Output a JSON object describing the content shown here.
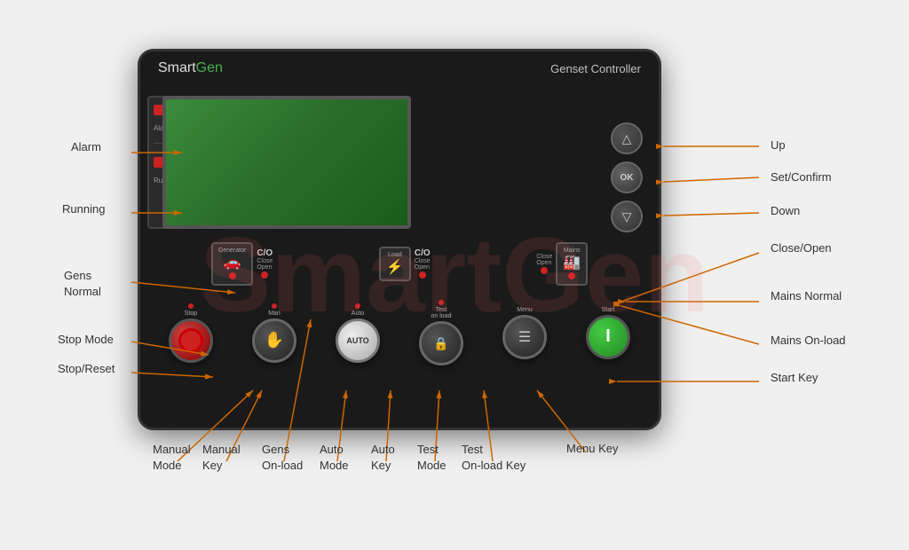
{
  "device": {
    "brand_smart": "Smart",
    "brand_gen": "Gen",
    "title": "Genset Controller"
  },
  "indicators": {
    "alarm_label": "Alarm",
    "running_label": "Running"
  },
  "contactors": {
    "generator_label": "Generator",
    "load_label": "Load",
    "mains_label": "Mains",
    "co_label": "C/O",
    "close_open": "Close\nOpen"
  },
  "buttons": {
    "stop_label": "Stop",
    "man_label": "Man",
    "auto_label": "AUTO",
    "test_label": "Test\non load",
    "menu_label": "Menu",
    "start_label": "Start",
    "stop_symbol": "○",
    "start_symbol": "I"
  },
  "nav_buttons": {
    "up_label": "Up",
    "ok_label": "OK",
    "down_label": "Down",
    "ok_text": "OK"
  },
  "annotations": {
    "alarm": "Alarm",
    "running": "Running",
    "gens_normal": "Gens\nNormal",
    "stop_mode": "Stop Mode",
    "stop_reset": "Stop/Reset",
    "manual_mode": "Manual\nMode",
    "manual_key": "Manual\nKey",
    "gens_on_load": "Gens\nOn-load",
    "auto_mode": "Auto\nMode",
    "auto_key": "Auto\nKey",
    "test_mode": "Test\nMode",
    "test_on_load_key": "Test\nOn-load Key",
    "menu_key": "Menu Key",
    "up": "Up",
    "set_confirm": "Set/Confirm",
    "down": "Down",
    "close_open": "Close/Open",
    "mains_normal": "Mains Normal",
    "mains_on_load": "Mains On-load",
    "start_key": "Start Key"
  },
  "colors": {
    "accent": "#ff9900",
    "brand_green": "#4caf50",
    "lcd_green": "#3a8c3a",
    "led_red": "#cc2222",
    "led_green": "#44cc44"
  }
}
